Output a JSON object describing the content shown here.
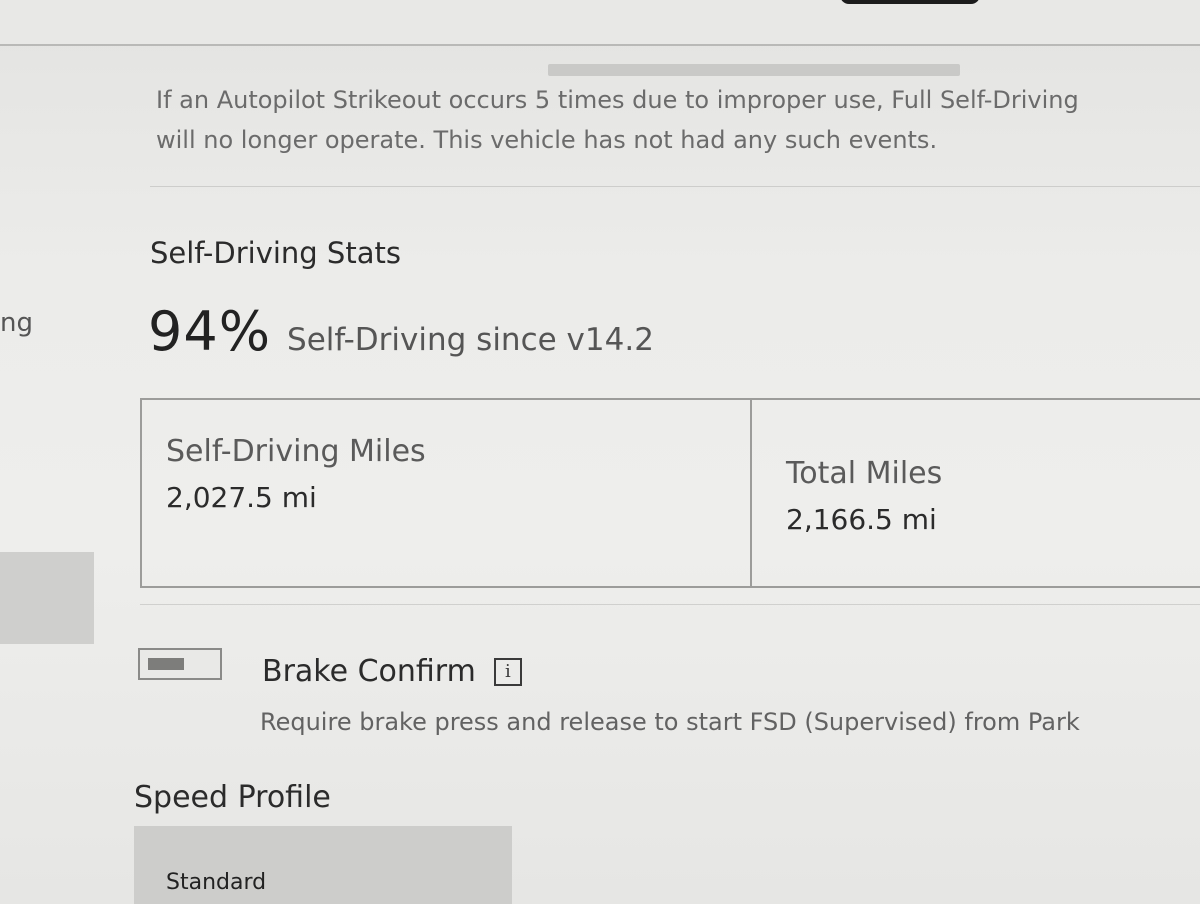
{
  "strikeout_notice": {
    "line1": "If an Autopilot Strikeout occurs 5 times due to improper use, Full Self-Driving",
    "line2": "will no longer operate. This vehicle has not had any such events."
  },
  "sidebar": {
    "partial_item_text": "ng"
  },
  "self_driving_stats": {
    "title": "Self-Driving Stats",
    "percent": "94%",
    "percent_caption": "Self-Driving since v14.2",
    "self_driving_miles_label": "Self-Driving Miles",
    "self_driving_miles_value": "2,027.5 mi",
    "total_miles_label": "Total Miles",
    "total_miles_value": "2,166.5 mi"
  },
  "brake_confirm": {
    "label": "Brake Confirm",
    "info_icon_glyph": "i",
    "description": "Require brake press and release to start FSD (Supervised) from Park",
    "toggle_state": "off"
  },
  "speed_profile": {
    "title": "Speed Profile",
    "selected_option": "Standard"
  }
}
